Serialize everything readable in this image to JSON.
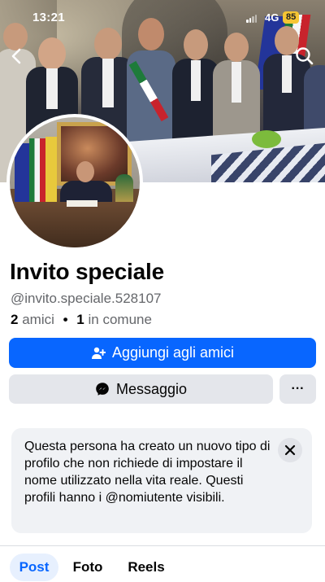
{
  "status_bar": {
    "time": "13:21",
    "network": "4G",
    "battery": "85"
  },
  "colors": {
    "primary": "#0866ff",
    "secondary_button": "#e4e6eb",
    "notice_bg": "#f0f2f5",
    "battery": "#f5c533"
  },
  "icons": {
    "back": "chevron-left-icon",
    "search": "search-icon",
    "add_friend": "add-friend-icon",
    "messenger": "messenger-icon",
    "more": "more-icon",
    "close": "close-icon"
  },
  "profile": {
    "name": "Invito speciale",
    "handle": "@invito.speciale.528107",
    "friends_count": "2",
    "friends_label": "amici",
    "mutual_count": "1",
    "mutual_label": "in comune"
  },
  "actions": {
    "add_friend": "Aggiungi agli amici",
    "message": "Messaggio",
    "more": "···"
  },
  "notice": {
    "text": "Questa persona ha creato un nuovo tipo di profilo che non richiede di impostare il nome utilizzato nella vita reale. Questi profili hanno i @nomiutente visibili."
  },
  "tabs": [
    {
      "label": "Post",
      "active": true
    },
    {
      "label": "Foto",
      "active": false
    },
    {
      "label": "Reels",
      "active": false
    }
  ]
}
